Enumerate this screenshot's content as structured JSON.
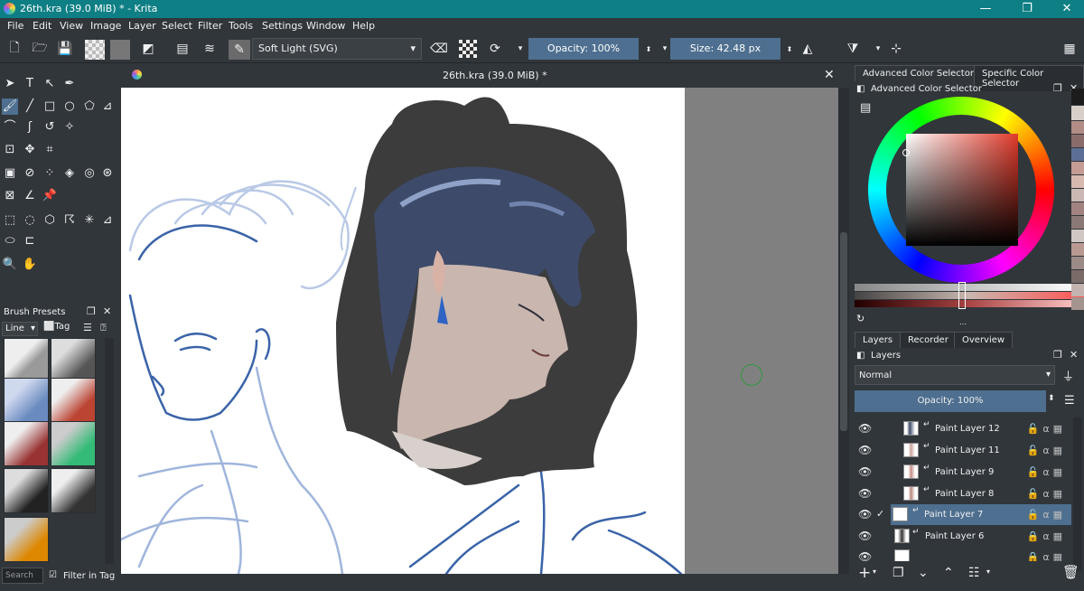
{
  "window": {
    "title": "26th.kra (39.0 MiB) * - Krita",
    "minimize": "—",
    "maximize": "❐",
    "close": "✕"
  },
  "menu": [
    "File",
    "Edit",
    "View",
    "Image",
    "Layer",
    "Select",
    "Filter",
    "Tools",
    "Settings",
    "Window",
    "Help"
  ],
  "toolbar": {
    "blend_mode": "Soft Light (SVG)",
    "opacity": "Opacity: 100%",
    "size": "Size: 42.48 px"
  },
  "document": {
    "tab_title": "26th.kra (39.0 MiB) *",
    "close": "✕"
  },
  "brush_presets": {
    "title": "Brush Presets",
    "filter_mode": "Line",
    "tag_label": "Tag",
    "search_placeholder": "Search",
    "filter_in_tag": "Filter in Tag"
  },
  "color_selector": {
    "tabs": [
      "Advanced Color Selector",
      "Specific Color Selector"
    ],
    "title": "Advanced Color Selector"
  },
  "layers_panel": {
    "tabs": [
      "Layers",
      "Recorder",
      "Overview"
    ],
    "title": "Layers",
    "blend_mode": "Normal",
    "opacity": "Opacity:  100%",
    "layers": [
      {
        "name": "Paint Layer 12",
        "selected": false
      },
      {
        "name": "Paint Layer 11",
        "selected": false
      },
      {
        "name": "Paint Layer 9",
        "selected": false
      },
      {
        "name": "Paint Layer 8",
        "selected": false
      },
      {
        "name": "Paint Layer 7",
        "selected": true
      },
      {
        "name": "Paint Layer 6",
        "selected": false
      }
    ]
  },
  "colors": {
    "titlebar": "#0e7f84",
    "selection": "#4e6f8f",
    "sketch_blue": "#3a63a8"
  }
}
